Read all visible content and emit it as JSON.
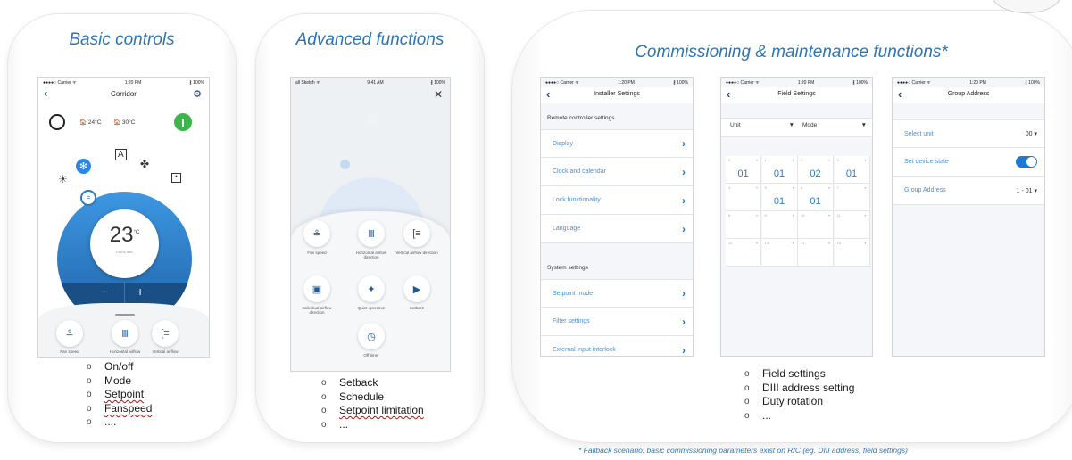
{
  "panels": {
    "basic": {
      "title": "Basic controls",
      "bullets": [
        "On/off",
        "Mode",
        "Setpoint",
        "Fanspeed",
        "...."
      ]
    },
    "advanced": {
      "title": "Advanced functions",
      "bullets": [
        "Setback",
        "Schedule",
        "Setpoint limitation",
        "..."
      ]
    },
    "commissioning": {
      "title": "Commissioning & maintenance functions*",
      "bullets": [
        "Field settings",
        "DIII address setting",
        "Duty rotation",
        "..."
      ]
    }
  },
  "footnote": "* Fallback scenario: basic commissioning parameters exist on R/C (eg. DIII address, field settings)",
  "bullet_marker": "o",
  "phone1": {
    "status": {
      "carrier": "●●●●○ Carrier ᯤ",
      "time": "1:20 PM",
      "battery": "∦ 100%"
    },
    "title": "Corridor",
    "indoor_temp": "24°C",
    "outdoor_temp": "30°C",
    "setpoint": "23",
    "unit": "°C",
    "mode": "COOLING",
    "minus": "−",
    "plus": "+",
    "buttons": [
      "Fan speed",
      "Horizontal airflow",
      "Vertical airflow"
    ]
  },
  "phone2": {
    "status": {
      "carrier": "all Sketch ᯤ",
      "time": "9:41 AM",
      "battery": "∦ 100%"
    },
    "close": "✕",
    "buttons": [
      "Fan speed",
      "Horizontal airflow direction",
      "Vertical airflow direction",
      "Individual airflow direction",
      "Quiet operation",
      "Setback",
      "Off timer"
    ]
  },
  "phone3": {
    "status": {
      "carrier": "●●●●○ Carrier ᯤ",
      "time": "1:20 PM",
      "battery": "∦ 100%"
    },
    "title": "Installer Settings",
    "section1": "Remote controller settings",
    "items1": [
      "Display",
      "Clock and calendar",
      "Lock functionality",
      "Language"
    ],
    "section2": "System settings",
    "items2": [
      "Setpoint mode",
      "Filter settings",
      "External input interlock"
    ]
  },
  "phone4": {
    "status": {
      "carrier": "●●●●○ Carrier ᯤ",
      "time": "1:20 PM",
      "battery": "∦ 100%"
    },
    "title": "Field Settings",
    "unit_label": "Unit",
    "mode_label": "Mode",
    "cells": [
      {
        "n": "0",
        "val": "01"
      },
      {
        "n": "1",
        "val": "01"
      },
      {
        "n": "2",
        "val": "02"
      },
      {
        "n": "3",
        "val": "01"
      },
      {
        "n": "4",
        "val": ""
      },
      {
        "n": "5",
        "val": "01"
      },
      {
        "n": "6",
        "val": "01"
      },
      {
        "n": "7",
        "val": ""
      },
      {
        "n": "8",
        "val": ""
      },
      {
        "n": "9",
        "val": ""
      },
      {
        "n": "10",
        "val": ""
      },
      {
        "n": "11",
        "val": ""
      },
      {
        "n": "12",
        "val": ""
      },
      {
        "n": "13",
        "val": ""
      },
      {
        "n": "14",
        "val": ""
      },
      {
        "n": "15",
        "val": ""
      }
    ]
  },
  "phone5": {
    "status": {
      "carrier": "●●●●○ Carrier ᯤ",
      "time": "1:20 PM",
      "battery": "∦ 100%"
    },
    "title": "Group Address",
    "select_unit_label": "Select unit",
    "select_unit_value": "00",
    "set_device_state_label": "Set device state",
    "set_device_state_on": true,
    "group_address_label": "Group Address",
    "group_address_value": "1 - 01"
  },
  "colors": {
    "accent": "#2e75b6",
    "ios_blue": "#1c7ad6",
    "dial_blue": "#2a78c2",
    "on_green": "#3db54a"
  }
}
